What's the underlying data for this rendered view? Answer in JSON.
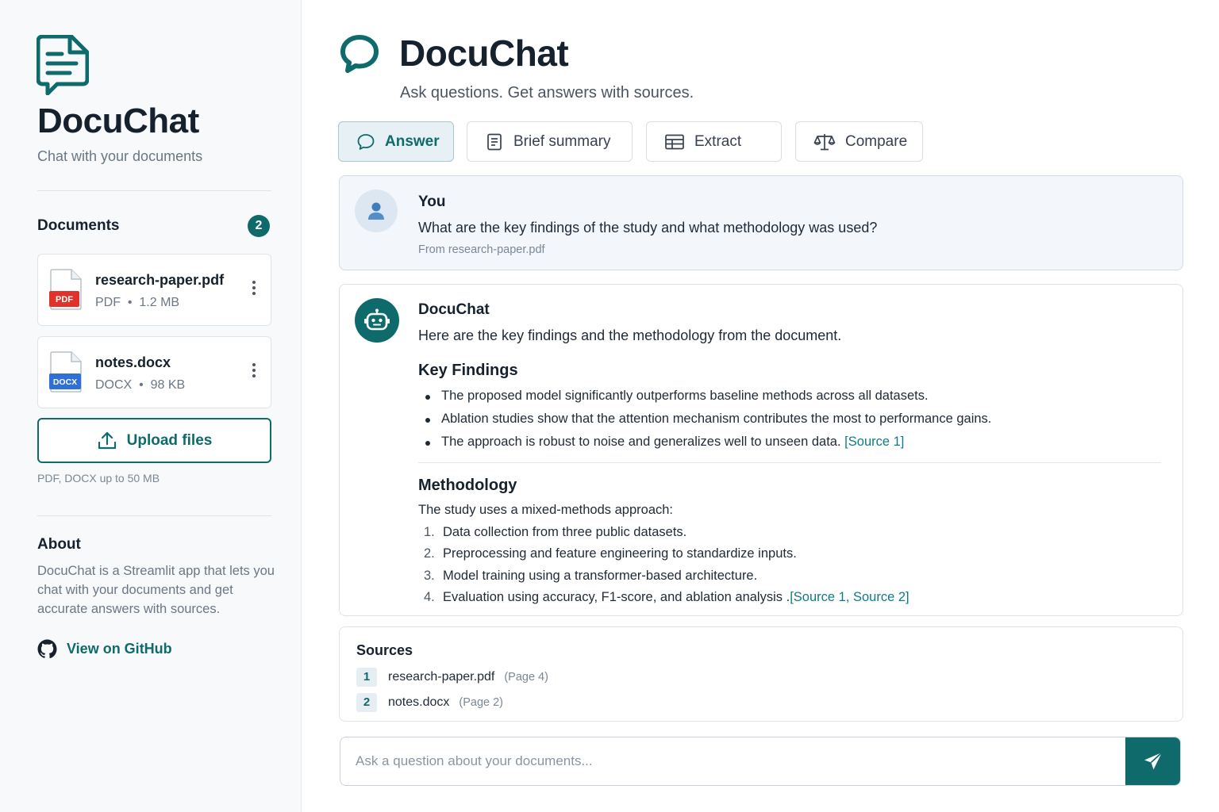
{
  "sidebar": {
    "brand_title": "DocuChat",
    "brand_subtitle": "Chat with your documents",
    "documents_heading": "Documents",
    "documents_count": "2",
    "documents": [
      {
        "name": "research-paper.pdf",
        "type_badge": "PDF",
        "meta": "PDF  •  1.2 MB",
        "badge_color": "#e0322b"
      },
      {
        "name": "notes.docx",
        "type_badge": "DOCX",
        "meta": "DOCX  •  98 KB",
        "badge_color": "#2f6fd6"
      }
    ],
    "upload_label": "Upload files",
    "upload_hint": "PDF, DOCX up to 50 MB",
    "about_heading": "About",
    "about_text": "DocuChat is a Streamlit app that lets you chat with your documents and get accurate answers with sources.",
    "github_label": "View on GitHub"
  },
  "header": {
    "title": "DocuChat",
    "subtitle": "Ask questions. Get answers with sources."
  },
  "tabs": [
    {
      "label": "Answer",
      "icon": "chat-bubble-icon",
      "active": true
    },
    {
      "label": "Brief summary",
      "icon": "document-icon",
      "active": false
    },
    {
      "label": "Extract",
      "icon": "table-icon",
      "active": false
    },
    {
      "label": "Compare",
      "icon": "scale-icon",
      "active": false
    }
  ],
  "user_message": {
    "author": "You",
    "text": "What are the key findings of the study and what methodology was used?",
    "from": "From research-paper.pdf"
  },
  "bot_message": {
    "author": "DocuChat",
    "intro": "Here are the key findings and the methodology from the document.",
    "findings_heading": "Key Findings",
    "findings": [
      "The proposed model significantly outperforms baseline methods across all datasets.",
      "Ablation studies show that the attention mechanism contributes the most to performance gains.",
      "The approach is robust to noise and generalizes well to unseen data."
    ],
    "findings_citation": "[Source 1]",
    "methodology_heading": "Methodology",
    "methodology_intro": "The study uses a mixed-methods approach:",
    "methodology_steps": [
      {
        "n": "1.",
        "text": "Data collection from three public datasets."
      },
      {
        "n": "2.",
        "text": "Preprocessing and feature engineering to standardize inputs."
      },
      {
        "n": "3.",
        "text": "Model training using a transformer-based architecture."
      },
      {
        "n": "4.",
        "text": "Evaluation using accuracy, F1-score, and ablation analysis ."
      }
    ],
    "methodology_citation": "[Source 1, Source 2]"
  },
  "sources": {
    "heading": "Sources",
    "items": [
      {
        "num": "1",
        "file": "research-paper.pdf",
        "page": "(Page 4)"
      },
      {
        "num": "2",
        "file": "notes.docx",
        "page": "(Page 2)"
      }
    ]
  },
  "composer": {
    "placeholder": "Ask a question about your documents..."
  },
  "colors": {
    "accent": "#0f6b6b",
    "citation": "#0f7a86"
  }
}
